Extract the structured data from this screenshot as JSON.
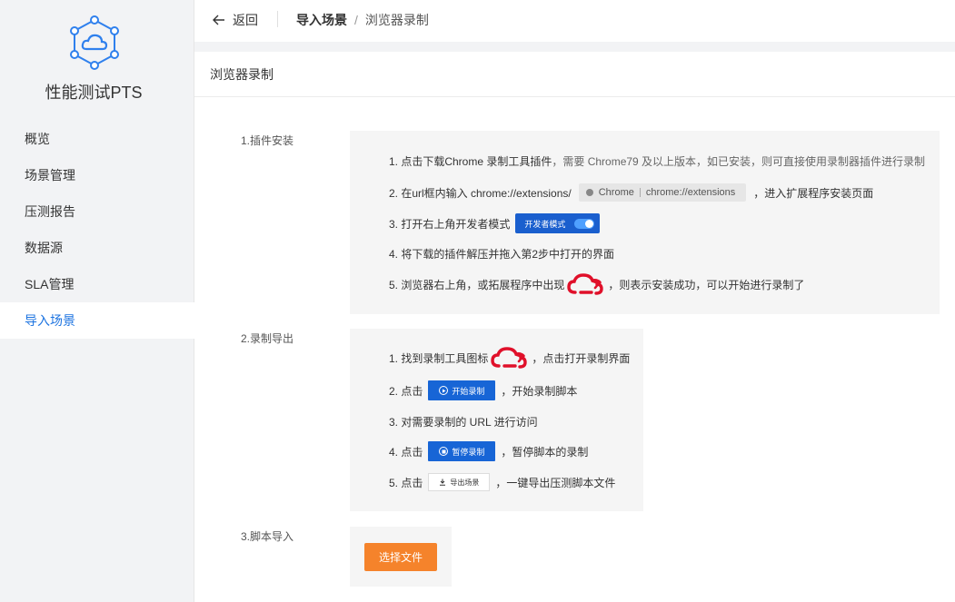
{
  "sidebar": {
    "product_name": "性能测试PTS",
    "items": [
      {
        "label": "概览"
      },
      {
        "label": "场景管理"
      },
      {
        "label": "压测报告"
      },
      {
        "label": "数据源"
      },
      {
        "label": "SLA管理"
      },
      {
        "label": "导入场景"
      }
    ],
    "active_index": 5
  },
  "topbar": {
    "back_label": "返回",
    "breadcrumb": [
      "导入场景",
      "/",
      "浏览器录制"
    ]
  },
  "main": {
    "title": "浏览器录制",
    "sections": {
      "install": {
        "label": "1.插件安装",
        "step1_prefix": "1. 点击下载Chrome 录制工具插件",
        "step1_suffix": "，需要 Chrome79 及以上版本，如已安装，则可直接使用录制器插件进行录制",
        "step2_prefix": "2. 在url框内输入 chrome://extensions/",
        "chip_left": "Chrome",
        "chip_right": "chrome://extensions",
        "step2_suffix": "，进入扩展程序安装页面",
        "step3": "3. 打开右上角开发者模式",
        "dev_mode_label": "开发者模式",
        "step4": "4. 将下载的插件解压并拖入第2步中打开的界面",
        "step5_prefix": "5. 浏览器右上角，或拓展程序中出现",
        "step5_suffix": "，则表示安装成功，可以开始进行录制了"
      },
      "record": {
        "label": "2.录制导出",
        "step1_prefix": "1. 找到录制工具图标",
        "step1_suffix": "，点击打开录制界面",
        "step2_prefix": "2. 点击",
        "start_btn": "开始录制",
        "step2_suffix": "，开始录制脚本",
        "step3": "3. 对需要录制的 URL 进行访问",
        "step4_prefix": "4. 点击",
        "pause_btn": "暂停录制",
        "step4_suffix": "，暂停脚本的录制",
        "step5_prefix": "5. 点击",
        "export_btn": "导出场景",
        "step5_suffix": "，一键导出压测脚本文件"
      },
      "import": {
        "label": "3.脚本导入",
        "choose_file": "选择文件"
      }
    }
  },
  "colors": {
    "accent_blue": "#1c73e0",
    "button_blue": "#1765d6",
    "orange": "#f5832b",
    "cloud_red": "#e0102a"
  }
}
